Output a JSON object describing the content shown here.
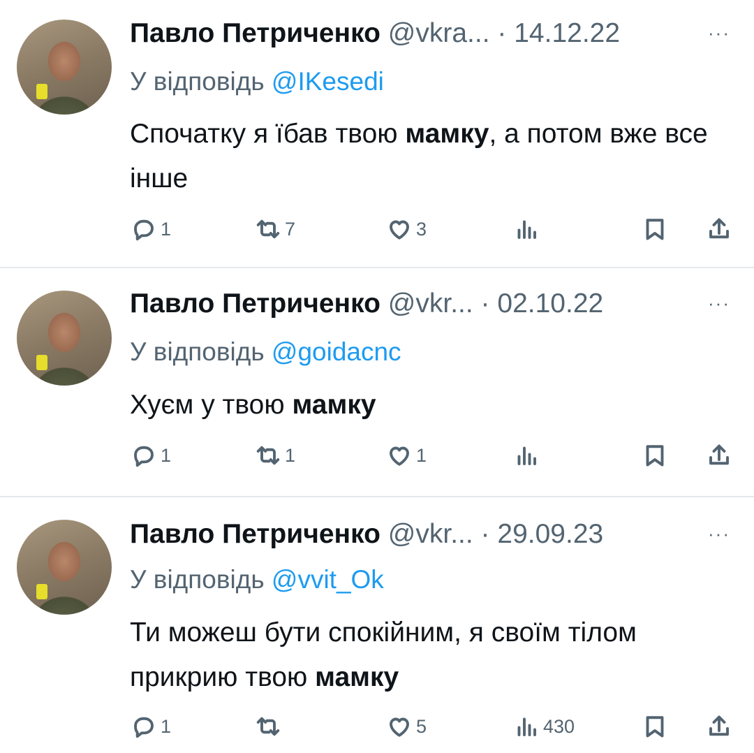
{
  "tweets": [
    {
      "author": "Павло Петриченко",
      "handle": "@vkra...",
      "separator": "·",
      "date": "14.12.22",
      "more": "···",
      "reply_prefix": "У відповідь",
      "reply_to": "@IKesedi",
      "text_before": "Спочатку я їбав твою ",
      "text_bold": "мамку",
      "text_after": ", а потом вже все інше",
      "replies": "1",
      "retweets": "7",
      "likes": "3",
      "views": ""
    },
    {
      "author": "Павло Петриченко",
      "handle": "@vkr...",
      "separator": "·",
      "date": "02.10.22",
      "more": "···",
      "reply_prefix": "У відповідь",
      "reply_to": "@goidacnc",
      "text_before": "Хуєм у твою ",
      "text_bold": "мамку",
      "text_after": "",
      "replies": "1",
      "retweets": "1",
      "likes": "1",
      "views": ""
    },
    {
      "author": "Павло Петриченко",
      "handle": "@vkr...",
      "separator": "·",
      "date": "29.09.23",
      "more": "···",
      "reply_prefix": "У відповідь",
      "reply_to": "@vvit_Ok",
      "text_before": "Ти можеш бути спокійним, я своїм тілом прикрию твою ",
      "text_bold": "мамку",
      "text_after": "",
      "replies": "1",
      "retweets": "",
      "likes": "5",
      "views": "430"
    }
  ],
  "icons": {
    "reply": "reply-icon",
    "retweet": "retweet-icon",
    "like": "heart-icon",
    "views": "views-icon",
    "bookmark": "bookmark-icon",
    "share": "share-icon",
    "more": "more-icon"
  },
  "colors": {
    "text": "#0f1419",
    "secondary": "#536471",
    "mention": "#1d9bf0",
    "divider": "#e6e9ec"
  }
}
